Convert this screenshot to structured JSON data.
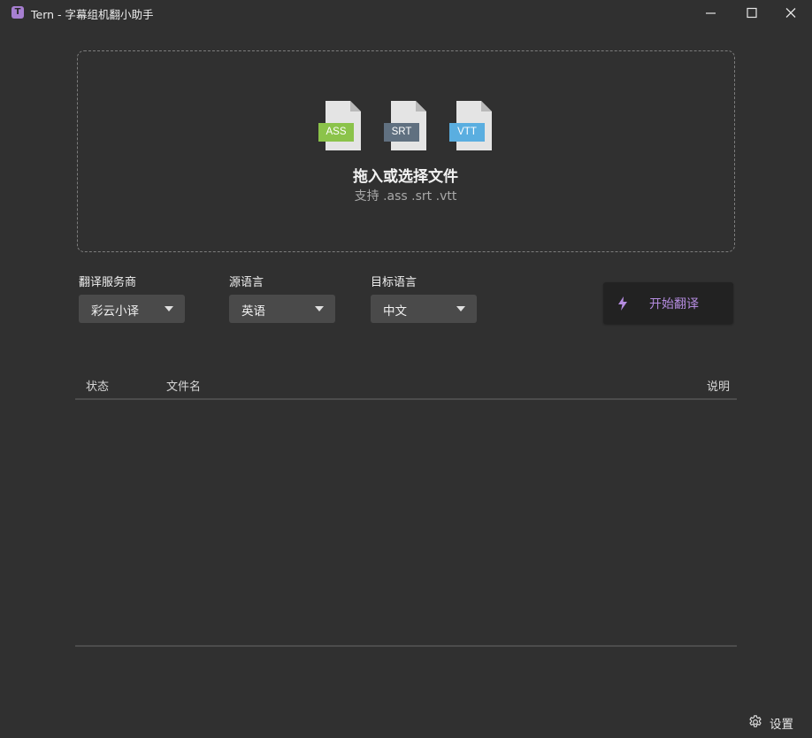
{
  "window": {
    "title": "Tern - 字幕组机翻小助手",
    "app_icon_letter": "T",
    "accent_color": "#a77fd1"
  },
  "dropzone": {
    "file_types": [
      {
        "label": "ASS",
        "color": "#8bc34a"
      },
      {
        "label": "SRT",
        "color": "#607080"
      },
      {
        "label": "VTT",
        "color": "#5aaee0"
      }
    ],
    "title": "拖入或选择文件",
    "subtitle": "支持 .ass .srt .vtt"
  },
  "options": {
    "provider": {
      "label": "翻译服务商",
      "value": "彩云小译"
    },
    "source_lang": {
      "label": "源语言",
      "value": "英语"
    },
    "target_lang": {
      "label": "目标语言",
      "value": "中文"
    }
  },
  "start_button": {
    "label": "开始翻译",
    "icon": "lightning-icon"
  },
  "table": {
    "columns": [
      "状态",
      "文件名",
      "说明"
    ],
    "rows": []
  },
  "footer": {
    "settings_label": "设置",
    "icon": "gear-icon"
  }
}
